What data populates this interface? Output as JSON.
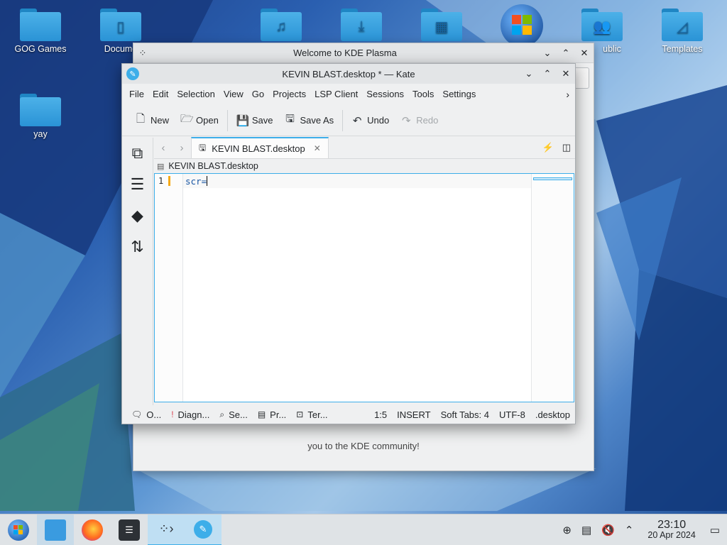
{
  "desktop": {
    "icons": [
      {
        "label": "GOG Games",
        "glyph": ""
      },
      {
        "label": "Docume",
        "glyph": "▯"
      },
      {
        "label": "",
        "glyph": "♫"
      },
      {
        "label": "",
        "glyph": "⤓"
      },
      {
        "label": "",
        "glyph": "▦"
      },
      {
        "label": "ublic",
        "glyph": "👥"
      },
      {
        "label": "Templates",
        "glyph": "◿"
      },
      {
        "label": "yay",
        "glyph": ""
      }
    ]
  },
  "welcome_window": {
    "title": "Welcome to KDE Plasma",
    "body_text": "you to the KDE community!"
  },
  "kate": {
    "title": "KEVIN BLAST.desktop * — Kate",
    "menu": [
      "File",
      "Edit",
      "Selection",
      "View",
      "Go",
      "Projects",
      "LSP Client",
      "Sessions",
      "Tools",
      "Settings"
    ],
    "toolbar": {
      "new": "New",
      "open": "Open",
      "save": "Save",
      "save_as": "Save As",
      "undo": "Undo",
      "redo": "Redo"
    },
    "tab": {
      "label": "KEVIN BLAST.desktop"
    },
    "breadcrumb": "KEVIN BLAST.desktop",
    "editor": {
      "line_number": "1",
      "code": "scr="
    },
    "status": {
      "output": "O...",
      "diagnostics": "Diagn...",
      "search": "Se...",
      "projects": "Pr...",
      "terminal": "Ter...",
      "cursor_pos": "1:5",
      "mode": "INSERT",
      "indent": "Soft Tabs: 4",
      "encoding": "UTF-8",
      "file_type": ".desktop"
    }
  },
  "taskbar": {
    "clock_time": "23:10",
    "clock_date": "20 Apr 2024"
  },
  "colors": {
    "accent": "#3daee9",
    "window_bg": "#eff0f1"
  }
}
